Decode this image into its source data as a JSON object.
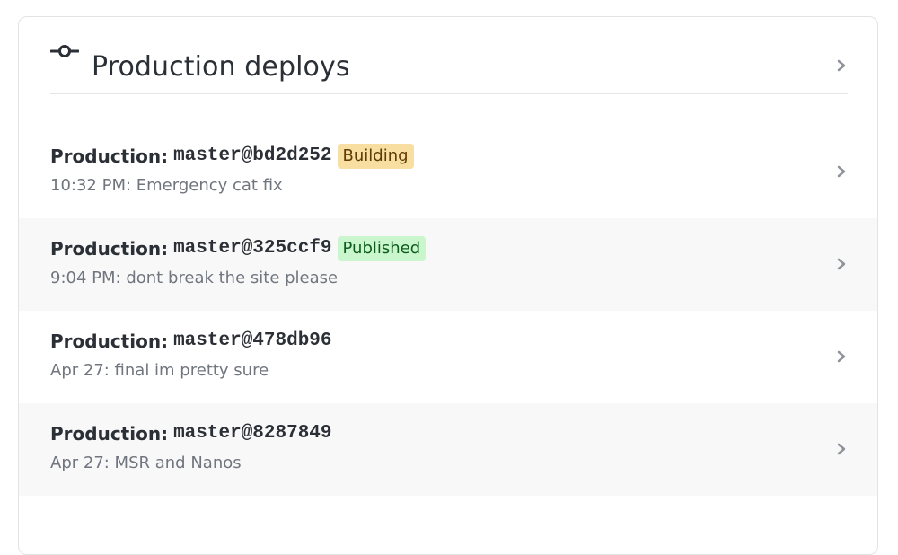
{
  "header": {
    "icon": "commit-icon",
    "title": "Production deploys",
    "chevron_icon": "chevron-right-icon"
  },
  "colors": {
    "building_badge_bg": "#f8dea0",
    "building_badge_text": "#5d3d05",
    "published_badge_bg": "#c9f6cd",
    "published_badge_text": "#0f5b1e",
    "alt_row_bg": "#f8f8f9"
  },
  "deploys": [
    {
      "env_label": "Production:",
      "ref": "master@bd2d252",
      "status": "Building",
      "subtitle": "10:32 PM: Emergency cat fix"
    },
    {
      "env_label": "Production:",
      "ref": "master@325ccf9",
      "status": "Published",
      "subtitle": "9:04 PM: dont break the site please"
    },
    {
      "env_label": "Production:",
      "ref": "master@478db96",
      "status": "",
      "subtitle": "Apr 27: final im pretty sure"
    },
    {
      "env_label": "Production:",
      "ref": "master@8287849",
      "status": "",
      "subtitle": "Apr 27: MSR and Nanos"
    }
  ]
}
